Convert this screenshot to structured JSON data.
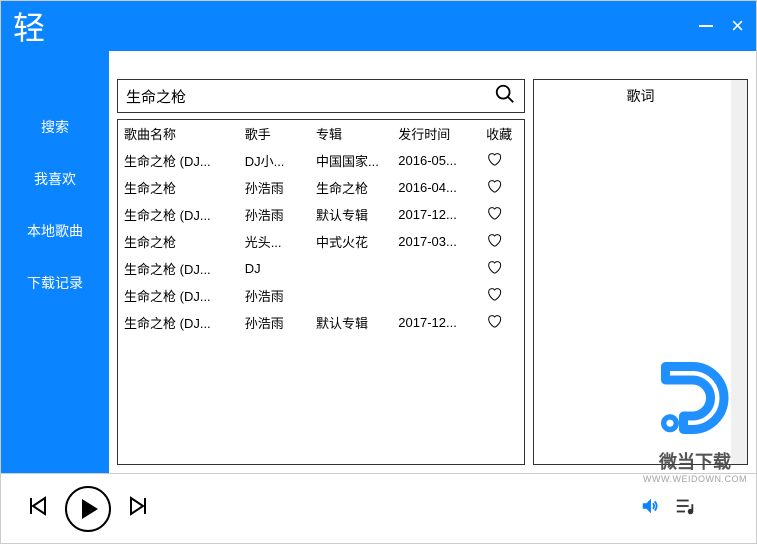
{
  "titlebar": {
    "logo": "轻"
  },
  "sidebar": {
    "items": [
      {
        "label": "搜索"
      },
      {
        "label": "我喜欢"
      },
      {
        "label": "本地歌曲"
      },
      {
        "label": "下载记录"
      }
    ]
  },
  "search": {
    "value": "生命之枪"
  },
  "columns": {
    "name": "歌曲名称",
    "artist": "歌手",
    "album": "专辑",
    "date": "发行时间",
    "fav": "收藏"
  },
  "rows": [
    {
      "name": "生命之枪 (DJ...",
      "artist": "DJ小...",
      "album": "中国国家...",
      "date": "2016-05..."
    },
    {
      "name": "生命之枪",
      "artist": "孙浩雨",
      "album": "生命之枪",
      "date": "2016-04..."
    },
    {
      "name": "生命之枪 (DJ...",
      "artist": "孙浩雨",
      "album": "默认专辑",
      "date": "2017-12..."
    },
    {
      "name": "生命之枪",
      "artist": "光头...",
      "album": "中式火花",
      "date": "2017-03..."
    },
    {
      "name": "生命之枪 (DJ...",
      "artist": "DJ",
      "album": "",
      "date": ""
    },
    {
      "name": "生命之枪 (DJ...",
      "artist": "孙浩雨",
      "album": "",
      "date": ""
    },
    {
      "name": "生命之枪 (DJ...",
      "artist": "孙浩雨",
      "album": "默认专辑",
      "date": "2017-12..."
    }
  ],
  "lyrics": {
    "title": "歌词"
  },
  "watermark": {
    "text": "微当下载",
    "url": "WWW.WEIDOWN.COM"
  }
}
